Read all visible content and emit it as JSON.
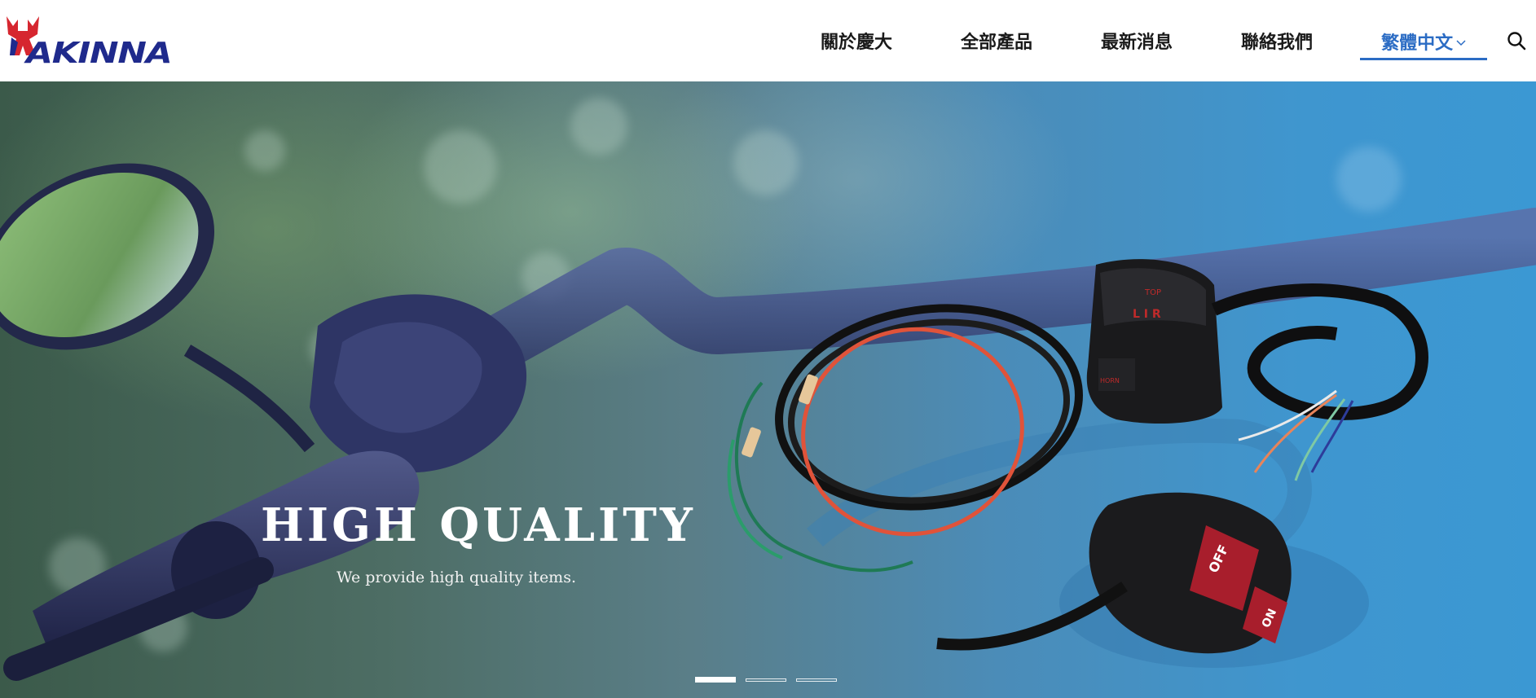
{
  "brand": {
    "logo_text": "AKINNA",
    "colors": {
      "logo_blue": "#1f2a8c",
      "logo_red": "#d6262f",
      "accent": "#2b6cc4"
    }
  },
  "nav": {
    "items": [
      {
        "label": "關於慶大"
      },
      {
        "label": "全部產品"
      },
      {
        "label": "最新消息"
      },
      {
        "label": "聯絡我們"
      }
    ],
    "language": {
      "label": "繁體中文",
      "icon": "chevron-down-icon"
    },
    "search_icon": "search-icon"
  },
  "hero": {
    "title": "HIGH QUALITY",
    "subtitle": "We provide high quality items.",
    "slides": {
      "count": 3,
      "active_index": 0
    },
    "switch_labels": {
      "off": "OFF",
      "on": "ON",
      "horn": "HORN"
    }
  }
}
